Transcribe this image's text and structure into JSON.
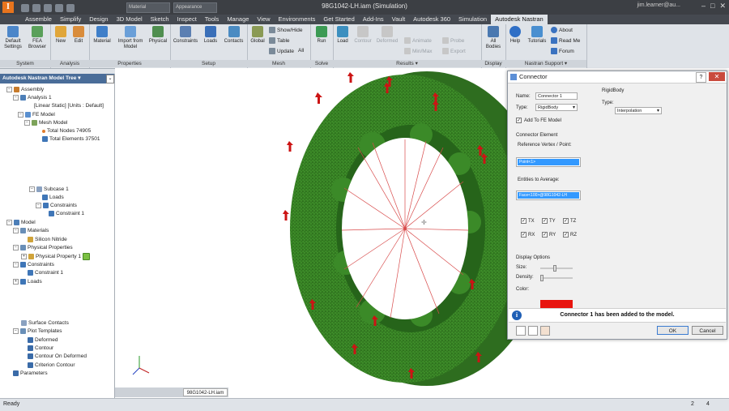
{
  "window": {
    "title": "98G1042-LH.iam (Simulation)",
    "material_select": "Material",
    "appearance_select": "Appearance",
    "user": "jim.learner@au...",
    "logo": "I"
  },
  "tabs": [
    "Assemble",
    "Simplify",
    "Design",
    "3D Model",
    "Sketch",
    "Inspect",
    "Tools",
    "Manage",
    "View",
    "Environments",
    "Get Started",
    "Add-Ins",
    "Vault",
    "Autodesk 360",
    "Simulation",
    "Autodesk Nastran"
  ],
  "active_tab": "Autodesk Nastran",
  "ribbon": {
    "system": {
      "label": "System",
      "buttons": [
        "Default Settings",
        "FEA Browser"
      ]
    },
    "analysis": {
      "label": "Analysis",
      "buttons": [
        "New",
        "Edit"
      ]
    },
    "properties": {
      "label": "Properties",
      "buttons": [
        "Material",
        "Import from Model",
        "Physical"
      ]
    },
    "setup": {
      "label": "Setup",
      "buttons": [
        "Constraints",
        "Loads",
        "Contacts"
      ]
    },
    "mesh": {
      "label": "Mesh",
      "buttons": [
        "Global"
      ],
      "small": [
        "Show/Hide",
        "Table",
        "Update",
        "All"
      ]
    },
    "solve": {
      "label": "Solve",
      "buttons": [
        "Run"
      ]
    },
    "results": {
      "label": "Results ▾",
      "buttons": [
        "Load",
        "Contour",
        "Deformed"
      ],
      "small": [
        "Animate",
        "Min/Max",
        "Probe",
        "Fast",
        "Export",
        "Report"
      ]
    },
    "display": {
      "label": "Display",
      "buttons": [
        "All Bodies"
      ]
    },
    "support": {
      "label": "Nastran Support ▾",
      "buttons": [
        "Help",
        "Tutorials"
      ],
      "small": [
        "About",
        "Read Me",
        "Forum"
      ]
    }
  },
  "tree": {
    "header": "Autodesk Nastran Model Tree ▾",
    "items": [
      "Assembly",
      "Analysis 1",
      "[Linear Static] [Units : Default]",
      "FE Model",
      "Mesh Model",
      "Total Nodes 74905",
      "Total Elements 37501",
      "Subcase 1",
      "Loads",
      "Constraints",
      "Constraint 1",
      "Model",
      "Materials",
      "Silicon Nitride",
      "Physical Properties",
      "Physical Property 1",
      "Constraints",
      "Constraint 1",
      "Loads",
      "Surface Contacts",
      "Plot Templates",
      "Deformed",
      "Contour",
      "Contour On Deformed",
      "Criterion Contour",
      "Parameters"
    ]
  },
  "doc_tab": "98G1042-LH.iam",
  "dialog": {
    "title": "Connector",
    "name_label": "Name:",
    "name_value": "Connector 1",
    "type_label": "Type:",
    "type_value": "RigidBody",
    "add_to_model": "Add To FE Model",
    "connector_element": "Connector Element",
    "ref_label": "Reference Vertex / Point:",
    "ref_value": "Point<1>",
    "entities_label": "Entities to Average:",
    "entities_value": "Face<100>@98G1042-LH",
    "dofs": [
      "TX",
      "TY",
      "TZ",
      "RX",
      "RY",
      "RZ"
    ],
    "display_options": "Display Options",
    "size_label": "Size:",
    "density_label": "Density:",
    "color_label": "Color:",
    "color_value": "#e8150f",
    "right_header": "RigidBody",
    "right_type_label": "Type:",
    "right_type_value": "Interpolation",
    "notification": "Connector 1 has been added to the model.",
    "ok": "OK",
    "cancel": "Cancel",
    "help": "?",
    "close": "✕"
  },
  "status": {
    "left": "Ready",
    "n1": "2",
    "n2": "4"
  }
}
